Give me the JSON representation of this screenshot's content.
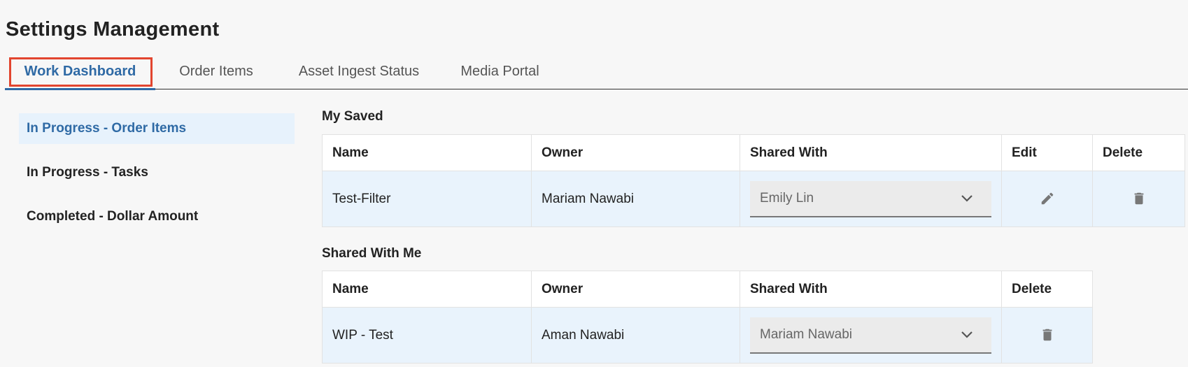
{
  "page": {
    "title": "Settings Management"
  },
  "tabs": [
    {
      "label": "Work Dashboard",
      "active": true
    },
    {
      "label": "Order Items"
    },
    {
      "label": "Asset Ingest Status"
    },
    {
      "label": "Media Portal"
    }
  ],
  "sidebar": {
    "items": [
      {
        "label": "In Progress - Order Items",
        "active": true
      },
      {
        "label": "In Progress - Tasks"
      },
      {
        "label": "Completed - Dollar Amount"
      }
    ]
  },
  "my_saved": {
    "title": "My Saved",
    "columns": [
      "Name",
      "Owner",
      "Shared With",
      "Edit",
      "Delete"
    ],
    "rows": [
      {
        "name": "Test-Filter",
        "owner": "Mariam Nawabi",
        "shared_with": "Emily Lin"
      }
    ]
  },
  "shared_with_me": {
    "title": "Shared With Me",
    "columns": [
      "Name",
      "Owner",
      "Shared With",
      "Delete"
    ],
    "rows": [
      {
        "name": "WIP - Test",
        "owner": "Aman Nawabi",
        "shared_with": "Mariam Nawabi"
      }
    ]
  },
  "icons": {
    "edit": "pencil-icon",
    "delete": "trash-icon",
    "dropdown": "chevron-down-icon"
  },
  "colors": {
    "accent": "#2f6aa5",
    "focus_outline": "#e2452f",
    "row_highlight": "#e9f3fc"
  }
}
